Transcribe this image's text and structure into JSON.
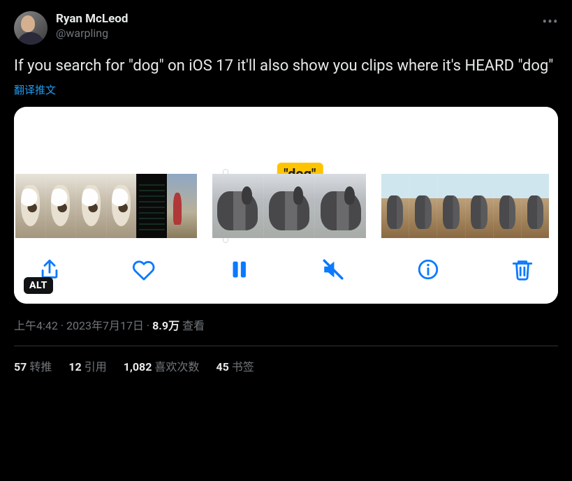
{
  "author": {
    "display_name": "Ryan McLeod",
    "handle": "@warpling"
  },
  "tweet_text": "If you search for \"dog\" on iOS 17 it'll also show you clips where it's HEARD \"dog\"",
  "translate_label": "翻译推文",
  "media": {
    "search_token": "\"dog\"",
    "alt_badge": "ALT",
    "toolbar_icons": [
      "share",
      "heart",
      "pause",
      "mute",
      "info",
      "trash"
    ]
  },
  "meta": {
    "time": "上午4:42",
    "date": "2023年7月17日",
    "views_count": "8.9万",
    "views_label": "查看"
  },
  "stats": {
    "retweets": {
      "count": "57",
      "label": "转推"
    },
    "quotes": {
      "count": "12",
      "label": "引用"
    },
    "likes": {
      "count": "1,082",
      "label": "喜欢次数"
    },
    "bookmarks": {
      "count": "45",
      "label": "书签"
    }
  }
}
